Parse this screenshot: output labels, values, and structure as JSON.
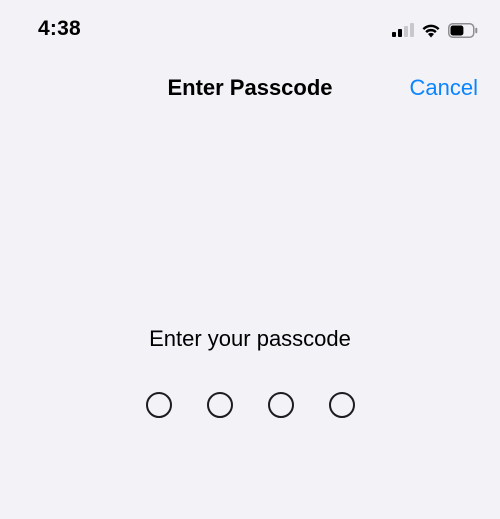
{
  "status_bar": {
    "time": "4:38",
    "icons": [
      "cellular-signal-icon",
      "wifi-icon",
      "battery-icon"
    ],
    "battery_level": 0.6,
    "signal_bars_active": 2,
    "signal_bars_total": 4
  },
  "nav": {
    "title": "Enter Passcode",
    "cancel_label": "Cancel",
    "accent_color": "#0a84ff"
  },
  "main": {
    "prompt": "Enter your passcode",
    "passcode_length": 4,
    "entered_digits": 0
  }
}
